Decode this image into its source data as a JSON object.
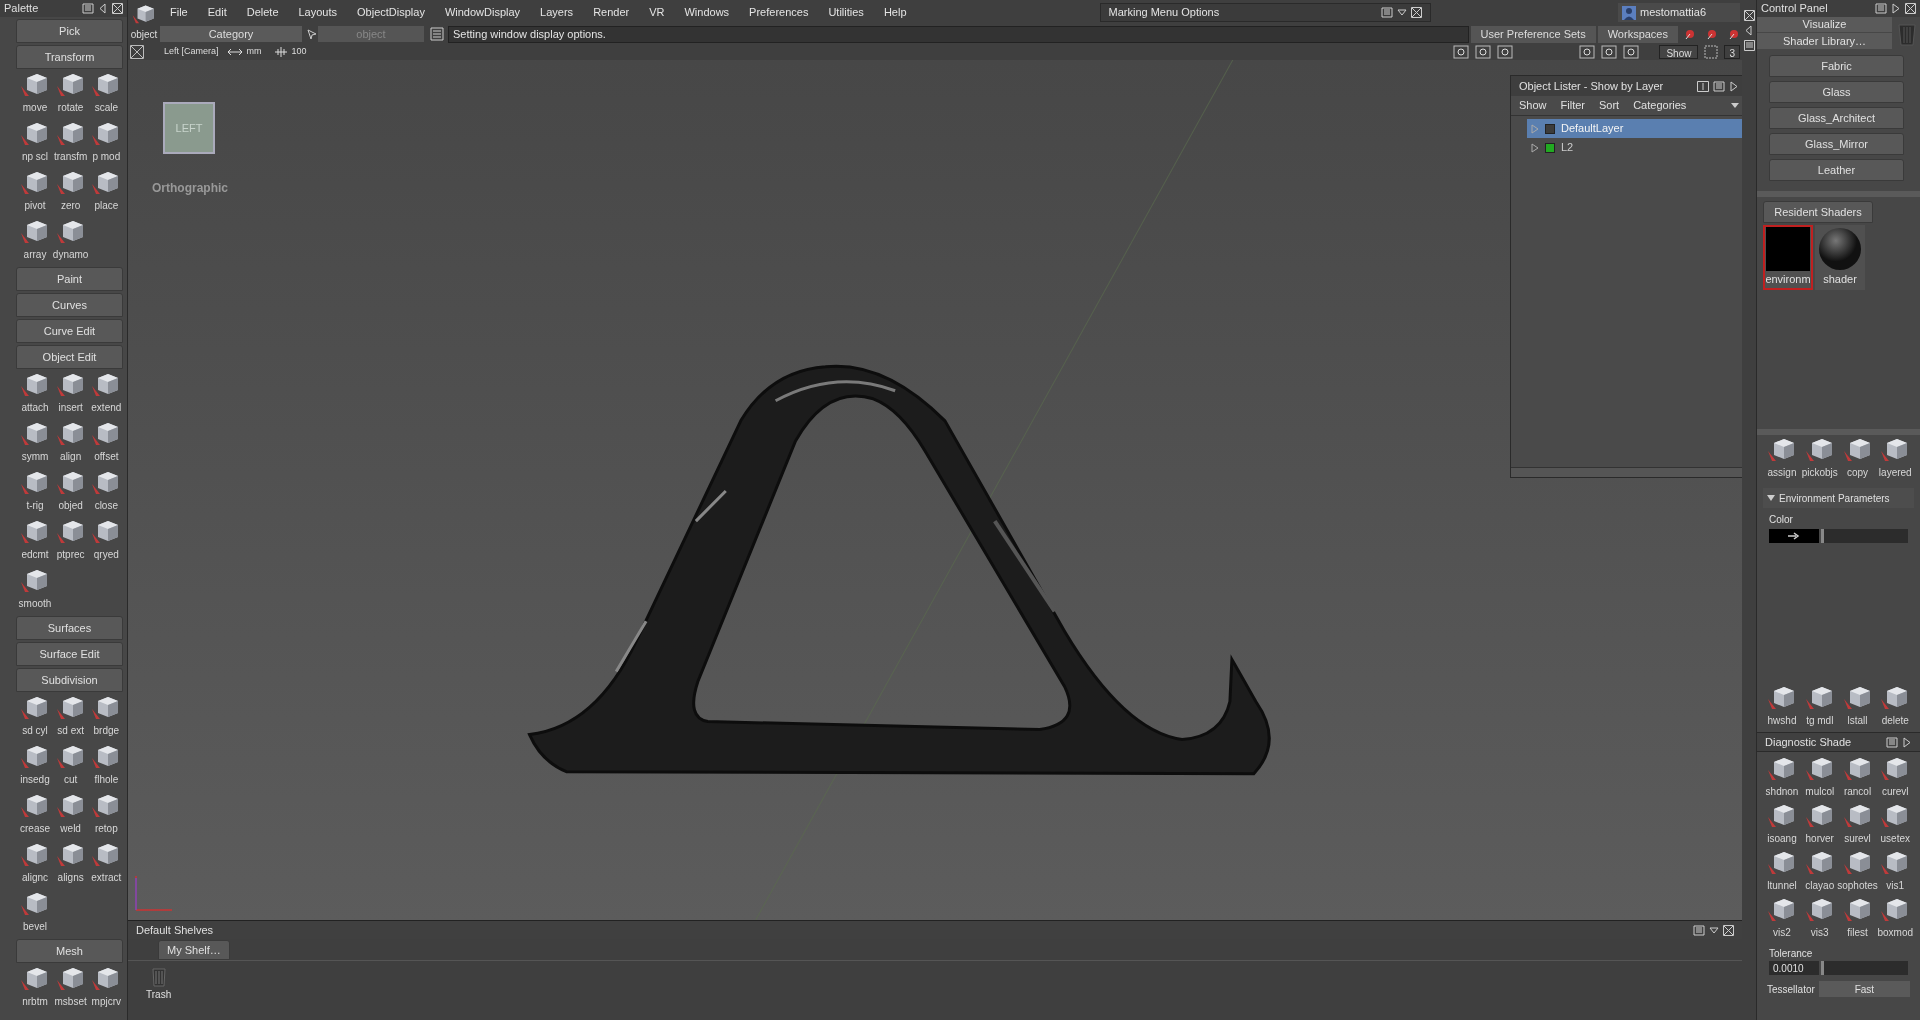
{
  "palette": {
    "title": "Palette",
    "sections": [
      {
        "label": "Pick"
      },
      {
        "label": "Transform",
        "tools": [
          "move",
          "rotate",
          "scale",
          "np scl",
          "transfm",
          "p mod",
          "pivot",
          "zero",
          "place",
          "array",
          "dynamo"
        ]
      },
      {
        "label": "Paint"
      },
      {
        "label": "Curves"
      },
      {
        "label": "Curve Edit"
      },
      {
        "label": "Object Edit",
        "tools": [
          "attach",
          "insert",
          "extend",
          "symm",
          "align",
          "offset",
          "t-rig",
          "objed",
          "close",
          "edcmt",
          "ptprec",
          "qryed",
          "smooth"
        ]
      },
      {
        "label": "Surfaces"
      },
      {
        "label": "Surface Edit"
      },
      {
        "label": "Subdivision",
        "tools": [
          "sd cyl",
          "sd ext",
          "brdge",
          "insedg",
          "cut",
          "flhole",
          "crease",
          "weld",
          "retop",
          "alignc",
          "aligns",
          "extract",
          "bevel"
        ]
      },
      {
        "label": "Mesh",
        "tools": [
          "nrbtm",
          "msbset",
          "mpjcrv"
        ]
      }
    ]
  },
  "mode_tool": "object",
  "menu": [
    "File",
    "Edit",
    "Delete",
    "Layouts",
    "ObjectDisplay",
    "WindowDisplay",
    "Layers",
    "Render",
    "VR",
    "Windows",
    "Preferences",
    "Utilities",
    "Help"
  ],
  "marking_menu": {
    "title": "Marking Menu Options"
  },
  "user": "mestomattia6",
  "toolbar": {
    "category": "Category",
    "object_placeholder": "object",
    "status": "Setting window display options.",
    "buttons": [
      "User Preference Sets",
      "Workspaces"
    ]
  },
  "viewport_header": {
    "camera": "Left [Camera]",
    "units": "mm",
    "grid": "100",
    "show": "Show",
    "count": "3"
  },
  "viewport": {
    "view_cube": "LEFT",
    "view_label": "Orthographic"
  },
  "object_lister": {
    "title": "Object Lister - Show by Layer",
    "menus": [
      "Show",
      "Filter",
      "Sort",
      "Categories"
    ],
    "layers": [
      {
        "name": "DefaultLayer",
        "selected": true,
        "color": "#3c3c3c"
      },
      {
        "name": "L2",
        "selected": false,
        "color": "#22aa22"
      }
    ]
  },
  "shelves": {
    "title": "Default Shelves",
    "tab": "My Shelf…",
    "items": [
      "Trash"
    ]
  },
  "control_panel": {
    "title": "Control Panel",
    "mode": "Visualize",
    "library": "Shader Library…",
    "library_items": [
      "Fabric",
      "Glass",
      "Glass_Architect",
      "Glass_Mirror",
      "Leather"
    ],
    "resident_title": "Resident Shaders",
    "shaders": [
      {
        "label": "environm",
        "selected": true,
        "kind": "flat"
      },
      {
        "label": "shader",
        "selected": false,
        "kind": "sphere"
      }
    ],
    "shader_tools": [
      "assign",
      "pickobjs",
      "copy",
      "layered"
    ],
    "env_title": "Environment Parameters",
    "color_label": "Color",
    "color_slider": {
      "level": 0
    },
    "env_tools": [
      "hwshd",
      "tg mdl",
      "lstall",
      "delete"
    ],
    "diagnostic_title": "Diagnostic Shade",
    "diagnostic_tools": [
      "shdnon",
      "mulcol",
      "rancol",
      "curevl",
      "isoang",
      "horver",
      "surevl",
      "usetex",
      "ltunnel",
      "clayao",
      "sophotes",
      "vis1",
      "vis2",
      "vis3",
      "filest",
      "boxmod"
    ],
    "tolerance_label": "Tolerance",
    "tolerance": "0.0010",
    "tolerance_slider": {
      "level": 0
    },
    "tessellator_label": "Tessellator",
    "tessellator": "Fast"
  }
}
